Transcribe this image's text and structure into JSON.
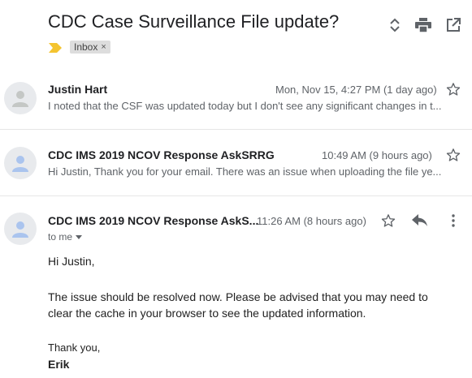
{
  "thread": {
    "subject": "CDC Case Surveillance File update?",
    "label": "Inbox",
    "label_remove": "×"
  },
  "messages": [
    {
      "sender": "Justin Hart",
      "date": "Mon, Nov 15, 4:27 PM (1 day ago)",
      "snippet": "I noted that the CSF was updated today but I don't see any significant changes in t..."
    },
    {
      "sender": "CDC IMS 2019 NCOV Response AskSRRG",
      "date": "10:49 AM (9 hours ago)",
      "snippet": "Hi Justin, Thank you for your email. There was an issue when uploading the file ye..."
    },
    {
      "sender": "CDC IMS 2019 NCOV Response AskS...",
      "date": "11:26 AM (8 hours ago)",
      "recipients": "to me",
      "greeting": "Hi Justin,",
      "paragraph_line1": "The issue should be resolved now. Please be advised that you may need to",
      "paragraph_line2": "clear the cache in your browser to see the updated information.",
      "closing": "Thank you,",
      "signature": "Erik"
    }
  ],
  "icons": {
    "expand": "unfold-icon",
    "print": "print-icon",
    "new_window": "open-in-new-window-icon",
    "label_marker": "important-marker-icon",
    "star": "star-icon",
    "reply": "reply-icon",
    "more": "more-vert-icon",
    "avatar": "person-icon",
    "dropdown": "caret-down-icon"
  },
  "colors": {
    "label_marker": "#f4c430",
    "avatar_bg": "#e8eaed",
    "avatar_person_grey": "#c4c7c5",
    "avatar_person_blue": "#aac4ee"
  }
}
